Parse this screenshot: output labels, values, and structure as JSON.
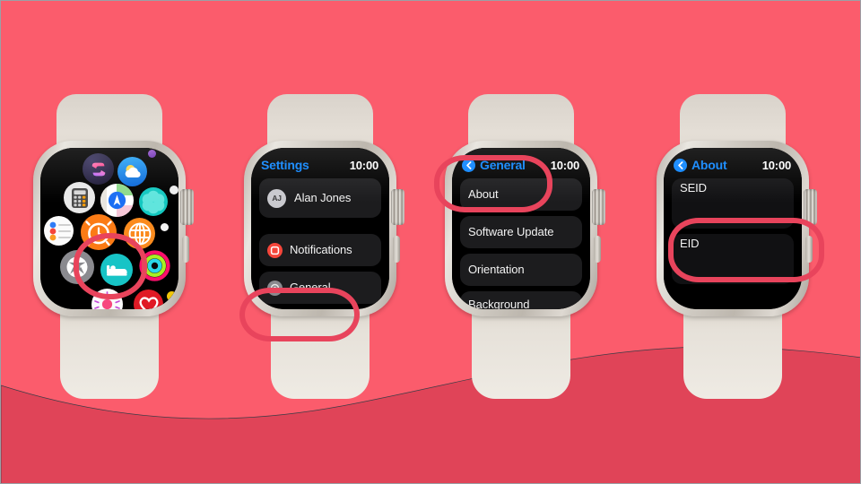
{
  "theme": {
    "bg_top": "#FB5C6C",
    "bg_wave": "#E04458",
    "annotation": "#E8445C",
    "accent_blue": "#0A84FF",
    "row_bg": "#1C1C1E",
    "band": "#DED8CF",
    "case": "#CFCAC2"
  },
  "watches": [
    {
      "id": "watch-app-grid",
      "screen_type": "app-grid",
      "apps": [
        {
          "name": "shortcuts-app-icon",
          "label": "Shortcuts"
        },
        {
          "name": "weather-app-icon",
          "label": "Weather"
        },
        {
          "name": "calculator-app-icon",
          "label": "Calculator"
        },
        {
          "name": "maps-app-icon",
          "label": "Maps"
        },
        {
          "name": "breathe-app-icon",
          "label": "Mindfulness"
        },
        {
          "name": "reminders-app-icon",
          "label": "Reminders"
        },
        {
          "name": "alarms-app-icon",
          "label": "Alarms"
        },
        {
          "name": "world-clock-app-icon",
          "label": "World Clock"
        },
        {
          "name": "settings-app-icon",
          "label": "Settings"
        },
        {
          "name": "sleep-app-icon",
          "label": "Sleep"
        },
        {
          "name": "activity-app-icon",
          "label": "Activity"
        },
        {
          "name": "cycle-tracking-app-icon",
          "label": "Cycle Tracking"
        },
        {
          "name": "heart-rate-app-icon",
          "label": "Heart Rate"
        }
      ],
      "highlight": {
        "target": "settings-app-icon"
      }
    },
    {
      "id": "watch-settings",
      "screen_type": "list",
      "header": {
        "title": "Settings",
        "has_back": false,
        "time": "10:00"
      },
      "rows": [
        {
          "label": "Alan Jones",
          "icon": "avatar",
          "initials": "AJ",
          "style": "tall"
        },
        {
          "label": "Notifications",
          "icon": "notifications-icon"
        },
        {
          "label": "General",
          "icon": "general-icon",
          "highlighted": true
        }
      ]
    },
    {
      "id": "watch-general",
      "screen_type": "list",
      "header": {
        "title": "General",
        "has_back": true,
        "time": "10:00"
      },
      "rows": [
        {
          "label": "About",
          "highlighted": true
        },
        {
          "label": "Software Update"
        },
        {
          "label": "Orientation"
        },
        {
          "label": "Background\nApp Refresh"
        }
      ]
    },
    {
      "id": "watch-about",
      "screen_type": "list",
      "header": {
        "title": "About",
        "has_back": true,
        "time": "10:00"
      },
      "rows": [
        {
          "label": "SEID",
          "style": "tall"
        },
        {
          "label": "EID",
          "style": "tall",
          "highlighted": true
        }
      ]
    }
  ]
}
